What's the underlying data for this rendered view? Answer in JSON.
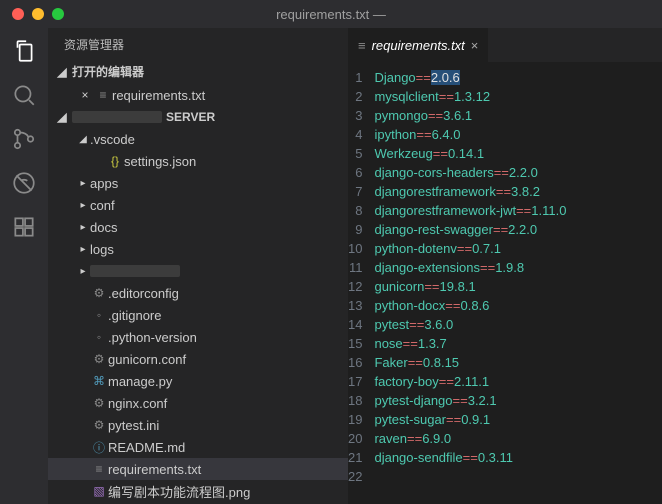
{
  "window": {
    "title": "requirements.txt —"
  },
  "explorer": {
    "title": "资源管理器",
    "open_editors_label": "打开的编辑器",
    "project_suffix": "SERVER",
    "open_editors": [
      {
        "name": "requirements.txt",
        "dirty": true
      }
    ],
    "tree": [
      {
        "indent": 1,
        "kind": "folder",
        "open": true,
        "name": ".vscode"
      },
      {
        "indent": 2,
        "kind": "file",
        "icon": "{}",
        "iconClass": "ic-yellow",
        "name": "settings.json"
      },
      {
        "indent": 1,
        "kind": "folder",
        "open": false,
        "name": "apps"
      },
      {
        "indent": 1,
        "kind": "folder",
        "open": false,
        "name": "conf"
      },
      {
        "indent": 1,
        "kind": "folder",
        "open": false,
        "name": "docs"
      },
      {
        "indent": 1,
        "kind": "folder",
        "open": false,
        "name": "logs"
      },
      {
        "indent": 1,
        "kind": "folder",
        "open": false,
        "obscured": true
      },
      {
        "indent": 1,
        "kind": "file",
        "icon": "⚙",
        "iconClass": "ic-gray",
        "name": ".editorconfig"
      },
      {
        "indent": 1,
        "kind": "file",
        "icon": "◦",
        "iconClass": "ic-gray",
        "name": ".gitignore"
      },
      {
        "indent": 1,
        "kind": "file",
        "icon": "◦",
        "iconClass": "ic-gray",
        "name": ".python-version"
      },
      {
        "indent": 1,
        "kind": "file",
        "icon": "⚙",
        "iconClass": "ic-gray",
        "name": "gunicorn.conf"
      },
      {
        "indent": 1,
        "kind": "file",
        "icon": "⌘",
        "iconClass": "ic-blue",
        "name": "manage.py"
      },
      {
        "indent": 1,
        "kind": "file",
        "icon": "⚙",
        "iconClass": "ic-gray",
        "name": "nginx.conf"
      },
      {
        "indent": 1,
        "kind": "file",
        "icon": "⚙",
        "iconClass": "ic-gray",
        "name": "pytest.ini"
      },
      {
        "indent": 1,
        "kind": "file",
        "icon": "ⓘ",
        "iconClass": "ic-blue",
        "name": "README.md"
      },
      {
        "indent": 1,
        "kind": "file",
        "icon": "≡",
        "iconClass": "ic-gray",
        "name": "requirements.txt",
        "selected": true
      },
      {
        "indent": 1,
        "kind": "file",
        "icon": "▧",
        "iconClass": "ic-purple",
        "name": "编写剧本功能流程图.png"
      }
    ]
  },
  "tab": {
    "name": "requirements.txt",
    "close": "×"
  },
  "code_lines": [
    {
      "pkg": "Django",
      "op": "==",
      "ver": "2.0.6",
      "sel": true
    },
    {
      "pkg": "mysqlclient",
      "op": "==",
      "ver": "1.3.12"
    },
    {
      "pkg": "pymongo",
      "op": "==",
      "ver": "3.6.1"
    },
    {
      "pkg": "ipython",
      "op": "==",
      "ver": "6.4.0"
    },
    {
      "pkg": "Werkzeug",
      "op": "==",
      "ver": "0.14.1"
    },
    {
      "pkg": "django-cors-headers",
      "op": "==",
      "ver": "2.2.0"
    },
    {
      "pkg": "djangorestframework",
      "op": "==",
      "ver": "3.8.2"
    },
    {
      "pkg": "djangorestframework-jwt",
      "op": "==",
      "ver": "1.11.0"
    },
    {
      "pkg": "django-rest-swagger",
      "op": "==",
      "ver": "2.2.0"
    },
    {
      "pkg": "python-dotenv",
      "op": "==",
      "ver": "0.7.1"
    },
    {
      "pkg": "django-extensions",
      "op": "==",
      "ver": "1.9.8"
    },
    {
      "pkg": "gunicorn",
      "op": "==",
      "ver": "19.8.1"
    },
    {
      "pkg": "python-docx",
      "op": "==",
      "ver": "0.8.6"
    },
    {
      "pkg": "pytest",
      "op": "==",
      "ver": "3.6.0"
    },
    {
      "pkg": "nose",
      "op": "==",
      "ver": "1.3.7"
    },
    {
      "pkg": "Faker",
      "op": "==",
      "ver": "0.8.15"
    },
    {
      "pkg": "factory-boy",
      "op": "==",
      "ver": "2.11.1"
    },
    {
      "pkg": "pytest-django",
      "op": "==",
      "ver": "3.2.1"
    },
    {
      "pkg": "pytest-sugar",
      "op": "==",
      "ver": "0.9.1"
    },
    {
      "pkg": "raven",
      "op": "==",
      "ver": "6.9.0"
    },
    {
      "pkg": "django-sendfile",
      "op": "==",
      "ver": "0.3.11"
    }
  ]
}
